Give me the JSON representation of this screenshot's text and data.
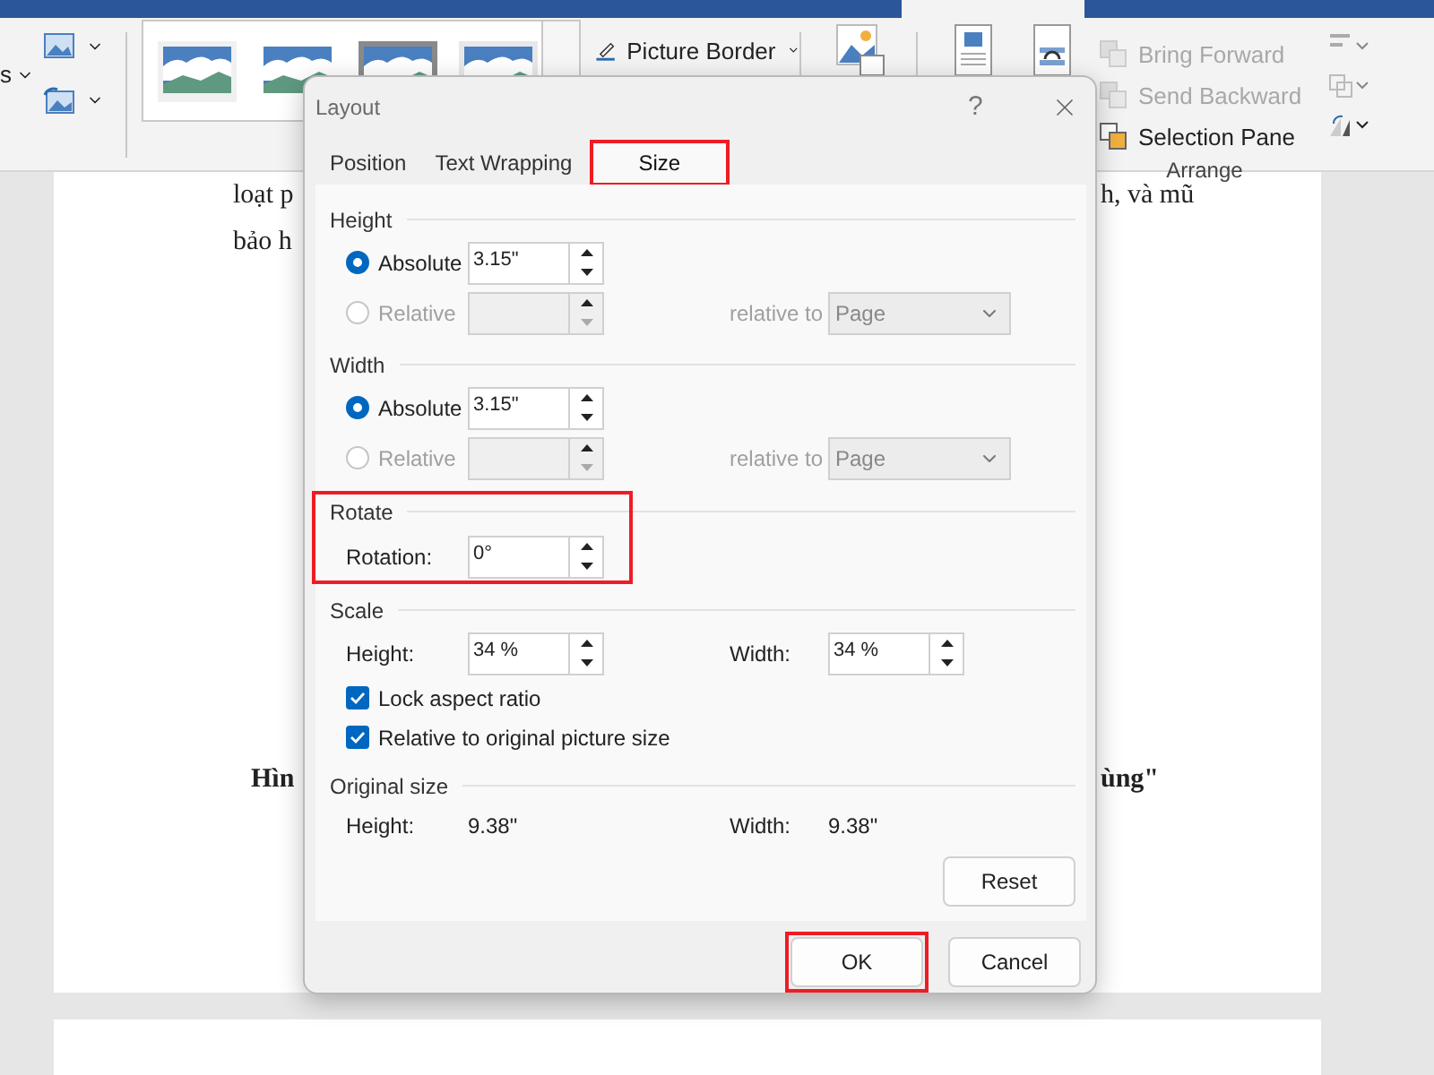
{
  "ribbon": {
    "cut_label": "s",
    "picture_border": "Picture Border",
    "arrange_items": [
      {
        "label": "Bring Forward",
        "disabled": true
      },
      {
        "label": "Send Backward",
        "disabled": true
      },
      {
        "label": "Selection Pane",
        "disabled": false
      }
    ],
    "group_label": "Arrange"
  },
  "document": {
    "lines": [
      {
        "left": "loạt p",
        "right": "h, và mũ"
      },
      {
        "left": "bảo h"
      }
    ],
    "caption": {
      "left": "Hìn",
      "right": "ùng\""
    }
  },
  "dialog": {
    "title": "Layout",
    "help": "?",
    "tabs": [
      {
        "label": "Position",
        "selected": false,
        "highlighted": false
      },
      {
        "label": "Text Wrapping",
        "selected": false,
        "highlighted": false
      },
      {
        "label": "Size",
        "selected": true,
        "highlighted": true
      }
    ],
    "sections": [
      {
        "kind": "dimension",
        "title": "Height",
        "highlighted": false,
        "absolute": {
          "label": "Absolute",
          "selected": true,
          "value": "3.15\""
        },
        "relative": {
          "label": "Relative",
          "selected": false,
          "disabled": true
        },
        "relative_to": {
          "label": "relative to",
          "value": "Page"
        }
      },
      {
        "kind": "dimension",
        "title": "Width",
        "highlighted": false,
        "absolute": {
          "label": "Absolute",
          "selected": true,
          "value": "3.15\""
        },
        "relative": {
          "label": "Relative",
          "selected": false,
          "disabled": true
        },
        "relative_to": {
          "label": "relative to",
          "value": "Page"
        }
      },
      {
        "kind": "rotate",
        "title": "Rotate",
        "highlighted": true,
        "label": "Rotation:",
        "value": "0°"
      },
      {
        "kind": "scale",
        "title": "Scale",
        "highlighted": false,
        "height_label": "Height:",
        "height_value": "34 %",
        "width_label": "Width:",
        "width_value": "34 %",
        "checkboxes": [
          {
            "label": "Lock aspect ratio",
            "checked": true
          },
          {
            "label": "Relative to original picture size",
            "checked": true
          }
        ]
      },
      {
        "kind": "original",
        "title": "Original size",
        "highlighted": false,
        "height_label": "Height:",
        "height_value": "9.38\"",
        "width_label": "Width:",
        "width_value": "9.38\""
      }
    ],
    "reset": "Reset",
    "buttons": [
      {
        "label": "OK",
        "highlighted": true
      },
      {
        "label": "Cancel",
        "highlighted": false
      }
    ]
  }
}
